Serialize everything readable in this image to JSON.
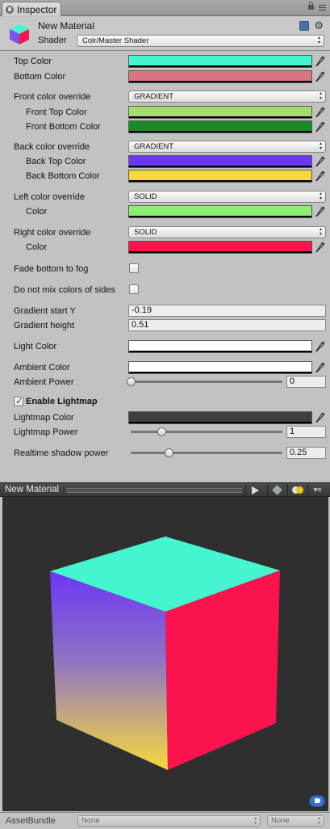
{
  "tab": {
    "label": "Inspector"
  },
  "header": {
    "material_name": "New Material",
    "shader_label": "Shader",
    "shader_value": "Colr/Master Shader"
  },
  "properties": {
    "top_color": {
      "label": "Top Color",
      "color": "#44f5d0"
    },
    "bottom_color": {
      "label": "Bottom Color",
      "color": "#d97582"
    },
    "front_override": {
      "label": "Front color override",
      "value": "GRADIENT"
    },
    "front_top_color": {
      "label": "Front Top Color",
      "color": "#a4dd6c"
    },
    "front_bottom_color": {
      "label": "Front Bottom Color",
      "color": "#1c8a24"
    },
    "back_override": {
      "label": "Back color override",
      "value": "GRADIENT"
    },
    "back_top_color": {
      "label": "Back Top Color",
      "color": "#6c36f5"
    },
    "back_bottom_color": {
      "label": "Back Bottom Color",
      "color": "#f7d93d"
    },
    "left_override": {
      "label": "Left color override",
      "value": "SOLID"
    },
    "left_color": {
      "label": "Color",
      "color": "#8aee72"
    },
    "right_override": {
      "label": "Right color override",
      "value": "SOLID"
    },
    "right_color": {
      "label": "Color",
      "color": "#fc134d"
    },
    "fade_bottom": {
      "label": "Fade bottom to fog",
      "checked": false
    },
    "no_mix": {
      "label": "Do not mix colors of sides",
      "checked": false
    },
    "gradient_start_y": {
      "label": "Gradient start Y",
      "value": "-0.19"
    },
    "gradient_height": {
      "label": "Gradient height",
      "value": "0.51"
    },
    "light_color": {
      "label": "Light Color",
      "color": "#ffffff"
    },
    "ambient_color": {
      "label": "Ambient Color",
      "color": "#ffffff"
    },
    "ambient_power": {
      "label": "Ambient Power",
      "value": "0",
      "fraction": 0
    },
    "enable_lightmap": {
      "label": "Enable Lightmap",
      "checked": true
    },
    "lightmap_color": {
      "label": "Lightmap Color",
      "color": "#3f3f3f"
    },
    "lightmap_power": {
      "label": "Lightmap Power",
      "value": "1",
      "fraction": 0.2
    },
    "shadow_power": {
      "label": "Realtime shadow power",
      "value": "0.25",
      "fraction": 0.25
    }
  },
  "preview": {
    "title": "New Material",
    "cube": {
      "top": "#44f5d0",
      "right": "#fc134d",
      "left_top": "#6c36f5",
      "left_bottom": "#f7d93d"
    }
  },
  "footer": {
    "label": "AssetBundle",
    "bundle": "None",
    "variant": "None"
  },
  "icons": [
    "inspector-icon",
    "lock-icon",
    "menu-icon",
    "book-icon",
    "gear-icon",
    "eyedropper-icon",
    "play-icon",
    "cube-icon",
    "light-icon",
    "tag-icon"
  ]
}
